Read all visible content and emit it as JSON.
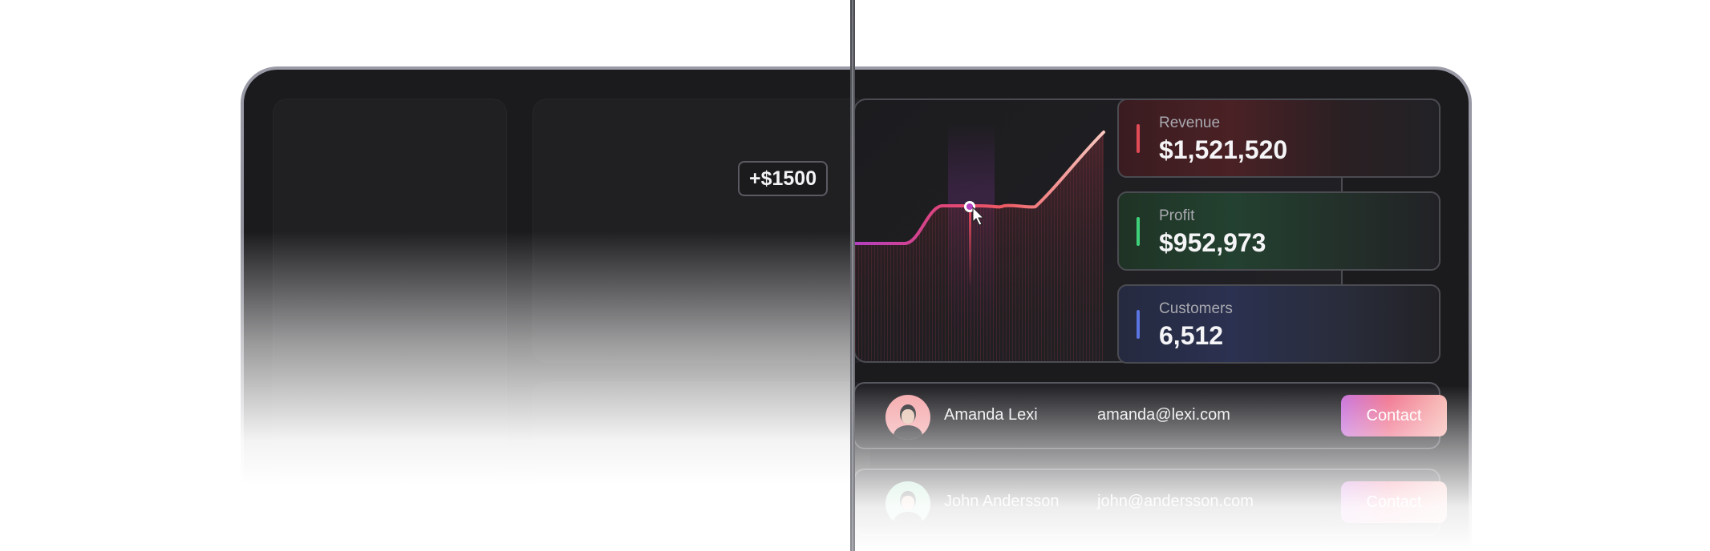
{
  "chart": {
    "tooltip": "+$1500",
    "colors": {
      "line_start": "#b340c0",
      "line_mid": "#e84a5f",
      "line_end": "#f8c8bf",
      "marker": "#b340c0"
    }
  },
  "stats": [
    {
      "label": "Revenue",
      "value": "$1,521,520",
      "color": "#e24b55"
    },
    {
      "label": "Profit",
      "value": "$952,973",
      "color": "#3fd17a"
    },
    {
      "label": "Customers",
      "value": "6,512",
      "color": "#5a74e0"
    }
  ],
  "contacts": [
    {
      "name": "Amanda Lexi",
      "email": "amanda@lexi.com",
      "button": "Contact"
    },
    {
      "name": "John Andersson",
      "email": "john@andersson.com",
      "button": "Contact"
    }
  ]
}
